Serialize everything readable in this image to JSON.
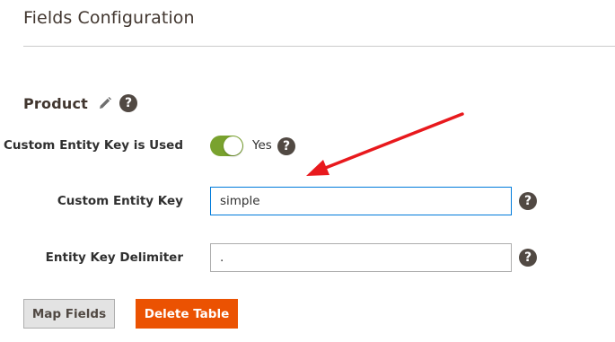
{
  "page": {
    "title": "Fields Configuration"
  },
  "section": {
    "title": "Product",
    "edit_icon": "pencil-icon",
    "help_icon": "question-mark-icon",
    "help_glyph": "?"
  },
  "fields": {
    "custom_entity_key_used": {
      "label": "Custom Entity Key is Used",
      "value": "Yes",
      "enabled": true
    },
    "custom_entity_key": {
      "label": "Custom Entity Key",
      "value": "simple"
    },
    "entity_key_delimiter": {
      "label": "Entity Key Delimiter",
      "value": "."
    }
  },
  "buttons": {
    "map_fields": "Map Fields",
    "delete_table": "Delete Table"
  },
  "colors": {
    "toggle_on": "#79a22e",
    "delete_button": "#eb5202",
    "arrow": "#e8191d",
    "help_icon_bg": "#514943",
    "input_focus": "#007bdb"
  }
}
